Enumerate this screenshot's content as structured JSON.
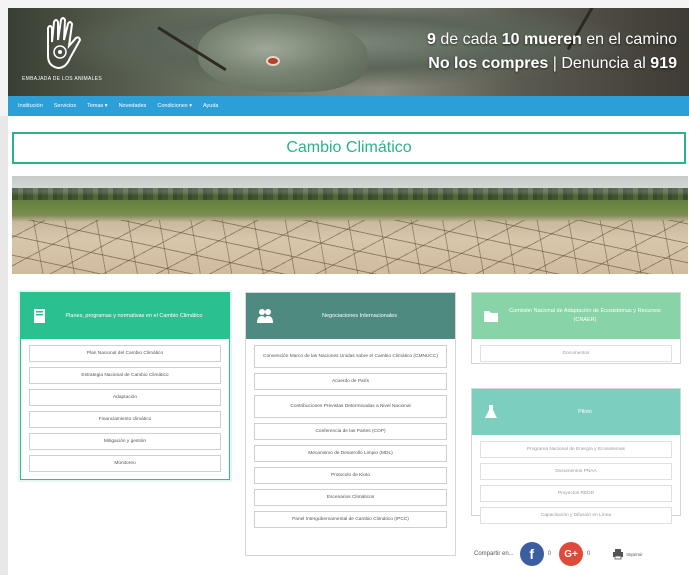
{
  "banner": {
    "logo_text": "EMBAJADA DE LOS ANIMALES",
    "slogan_line1_parts": [
      "9",
      " de cada ",
      "10 mueren",
      " en el camino"
    ],
    "slogan_line2_parts": [
      "No los compres",
      " | Denuncia al ",
      "919"
    ]
  },
  "nav": {
    "items": [
      "Institución",
      "Servicios",
      "Temas ▾",
      "Novedades",
      "Condiciones ▾",
      "Ayuda"
    ]
  },
  "page": {
    "title": "Cambio Climático"
  },
  "columns": {
    "left": {
      "title": "Planes, programas y normativas en el Cambio Climático",
      "items": [
        "Plan Nacional del Cambio Climático",
        "Estrategia Nacional de Cambio Climático",
        "Adaptación",
        "Financiamiento climático",
        "Mitigación y gestión",
        "Monitoreo"
      ]
    },
    "middle": {
      "title": "Negociaciones Internacionales",
      "items": [
        "Convención Marco de las Naciones Unidas sobre el Cambio Climático (CMNUCC)",
        "Acuerdo de París",
        "Contribuciones Previstas Determinadas a Nivel Nacional",
        "Conferencia de las Partes (COP)",
        "Mecanismo de Desarrollo Limpio (MDL)",
        "Protocolo de Kioto",
        "Escenarios Climáticos",
        "Panel Intergubernamental de Cambio Climático (IPCC)"
      ]
    },
    "right_top": {
      "title": "Comisión Nacional de Adaptación de Ecosistemas y Recursos (CNAER)",
      "items": [
        "Documentos"
      ]
    },
    "right_bottom": {
      "title": "Piloto",
      "items": [
        "Programa Nacional de Energía y Ecosistemas",
        "Documentos PNAA",
        "Proyectos REDD",
        "Capacitación y Difusión en Línea"
      ]
    }
  },
  "share": {
    "label": "Compartir en...",
    "facebook_icon": "f",
    "facebook_count": "0",
    "google_icon": "G+",
    "google_count": "0",
    "print_label": "Imprimir"
  },
  "colors": {
    "accent_green": "#2bc08f",
    "nav_blue": "#2d9fd8",
    "slate": "#4f8a80"
  }
}
